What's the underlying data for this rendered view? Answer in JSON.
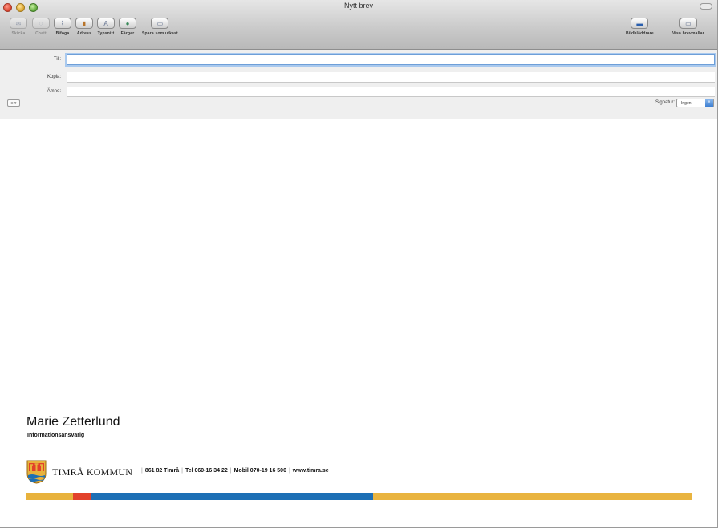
{
  "window": {
    "title": "Nytt brev"
  },
  "toolbar": {
    "left_buttons": [
      {
        "label": "Skicka",
        "icon": "send-icon",
        "enabled": false
      },
      {
        "label": "Chatt",
        "icon": "chat-icon",
        "enabled": false
      },
      {
        "label": "Bifoga",
        "icon": "paperclip-icon",
        "enabled": true
      },
      {
        "label": "Adress",
        "icon": "address-book-icon",
        "enabled": true
      },
      {
        "label": "Typsnitt",
        "icon": "font-icon",
        "enabled": true
      },
      {
        "label": "Färger",
        "icon": "colors-icon",
        "enabled": true
      },
      {
        "label": "Spara som utkast",
        "icon": "draft-icon",
        "enabled": true
      }
    ],
    "right_buttons": [
      {
        "label": "Bildbläddrare",
        "icon": "photo-browser-icon"
      },
      {
        "label": "Visa brevmallar",
        "icon": "stationery-icon"
      }
    ]
  },
  "header": {
    "to_label": "Till:",
    "to_value": "",
    "cc_label": "Kopia:",
    "cc_value": "",
    "subject_label": "Ämne:",
    "subject_value": "",
    "priority_label": "≡ ▾",
    "signature_label": "Signatur:",
    "signature_value": "Ingen"
  },
  "signature": {
    "name": "Marie Zetterlund",
    "role": "Informationsansvarig",
    "organization": "TIMRÅ KOMMUN",
    "contact": [
      "861 82 Timrå",
      "Tel 060-16 34 22",
      "Mobil 070-19 16 500",
      "www.timra.se"
    ],
    "crest_icon": "municipal-crest-icon"
  },
  "colors": {
    "stripe_yellow": "#e8b23c",
    "stripe_red": "#e2412a",
    "stripe_blue": "#1d6fb5",
    "stripe_gold": "#e9b440"
  }
}
